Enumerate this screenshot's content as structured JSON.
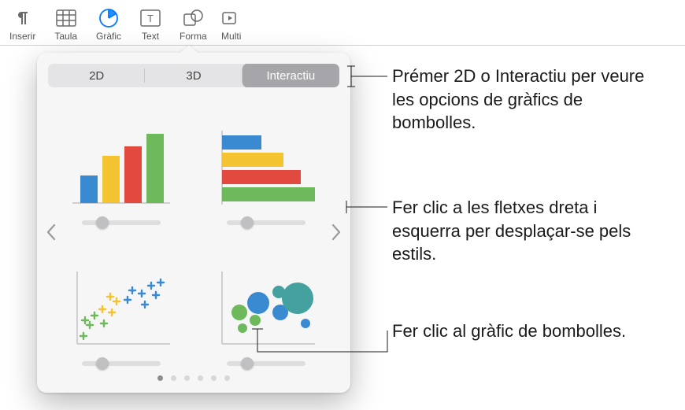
{
  "toolbar": {
    "items": [
      {
        "label": "Inserir",
        "icon": "pilcrow"
      },
      {
        "label": "Taula",
        "icon": "table"
      },
      {
        "label": "Gràfic",
        "icon": "pie-chart",
        "active": true
      },
      {
        "label": "Text",
        "icon": "text-box"
      },
      {
        "label": "Forma",
        "icon": "shape"
      },
      {
        "label": "Multi",
        "icon": "video",
        "clipped": true
      }
    ]
  },
  "popover": {
    "tabs": {
      "a": "2D",
      "b": "3D",
      "c": "Interactiu",
      "selected": "c"
    },
    "page_dots": 6,
    "current_page": 1,
    "chart_types": [
      "column-chart",
      "bar-chart",
      "scatter-plot",
      "bubble-chart"
    ],
    "chart_colors": {
      "blue": "#3a8ad2",
      "yellow": "#f4c430",
      "red": "#e24a40",
      "green": "#6db95b",
      "teal": "#45a0a0"
    }
  },
  "callouts": {
    "c1": "Prémer 2D o Interactiu per veure les opcions de gràfics de bombolles.",
    "c2": "Fer clic a les fletxes dreta i esquerra per desplaçar-se pels estils.",
    "c3": "Fer clic al gràfic de bombolles."
  }
}
